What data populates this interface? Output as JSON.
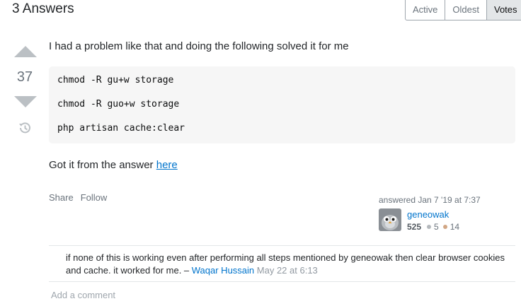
{
  "header": {
    "answers_count": "3 Answers",
    "sort_tabs": [
      "Active",
      "Oldest",
      "Votes"
    ],
    "active_tab": "Votes"
  },
  "vote": {
    "count": "37"
  },
  "post": {
    "intro": "I had a problem like that and doing the following solved it for me",
    "code_lines": [
      "chmod -R gu+w storage",
      "chmod -R guo+w storage",
      "php artisan cache:clear"
    ],
    "source_prefix": "Got it from the answer ",
    "source_link": "here"
  },
  "menu": {
    "share": "Share",
    "follow": "Follow"
  },
  "user": {
    "action": "answered Jan 7 '19 at 7:37",
    "name": "geneowak",
    "reputation": "525",
    "silver_badges": "5",
    "bronze_badges": "14",
    "silver_color": "#b4b8bc",
    "bronze_color": "#d1a684"
  },
  "comment": {
    "text": "if none of this is working even after performing all steps mentioned by geneowak then clear browser cookies and cache. it worked for me. – ",
    "author": "Waqar Hussain",
    "date": "May 22 at 6:13"
  },
  "add_comment": "Add a comment"
}
